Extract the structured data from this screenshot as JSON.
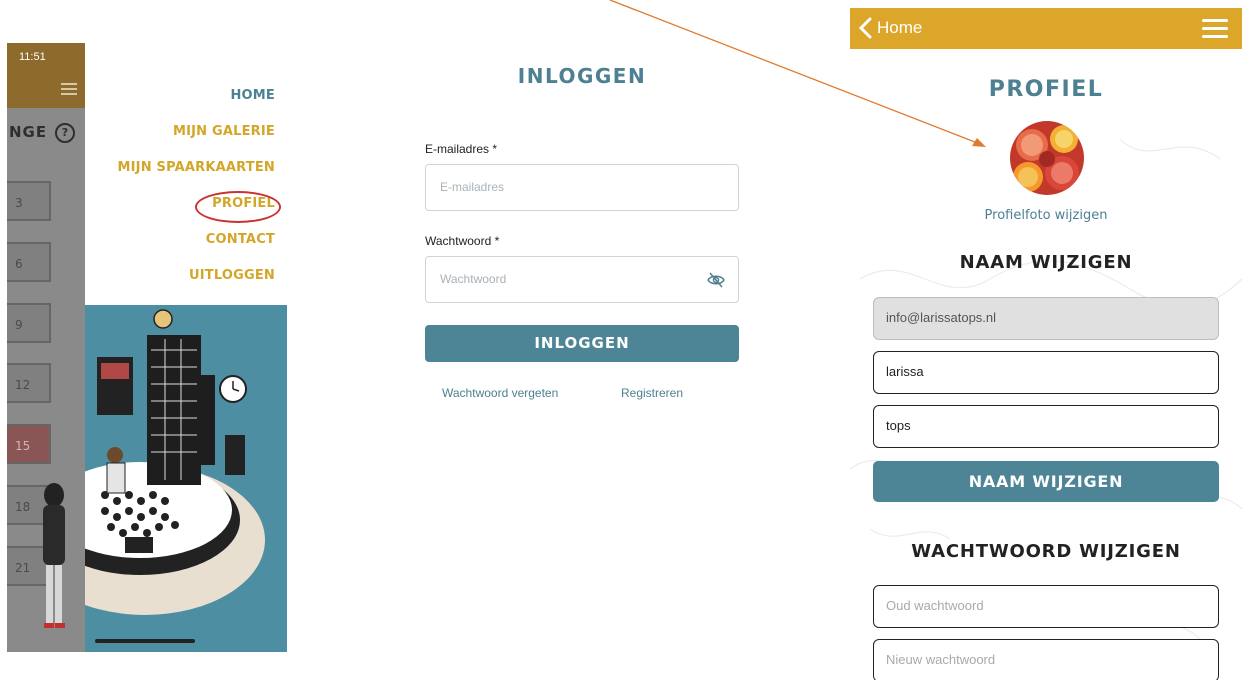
{
  "left_phone": {
    "status_time": "11:51",
    "partial_title": "NGE",
    "calendar_days": [
      "3",
      "6",
      "9",
      "12",
      "15",
      "18",
      "21"
    ],
    "menu": {
      "home": "HOME",
      "gallery": "MIJN GALERIE",
      "cards": "MIJN SPAARKAARTEN",
      "profile": "PROFIEL",
      "contact": "CONTACT",
      "logout": "UITLOGGEN"
    }
  },
  "login": {
    "title": "INLOGGEN",
    "email_label": "E-mailadres *",
    "email_placeholder": "E-mailadres",
    "password_label": "Wachtwoord *",
    "password_placeholder": "Wachtwoord",
    "submit_label": "INLOGGEN",
    "forgot_link": "Wachtwoord vergeten",
    "register_link": "Registreren"
  },
  "profile": {
    "back_label": "Home",
    "title": "PROFIEL",
    "change_photo": "Profielfoto wijzigen",
    "name_section_title": "NAAM WIJZIGEN",
    "email_value": "info@larissatops.nl",
    "first_name_value": "larissa",
    "last_name_value": "tops",
    "name_button": "NAAM WIJZIGEN",
    "password_section_title": "WACHTWOORD WIJZIGEN",
    "old_password_placeholder": "Oud wachtwoord",
    "new_password_placeholder": "Nieuw wachtwoord"
  },
  "colors": {
    "accent_gold": "#dba62a",
    "accent_teal": "#4e8596",
    "annotation_arrow": "#e07a2e",
    "annotation_circle": "#c9332f"
  }
}
